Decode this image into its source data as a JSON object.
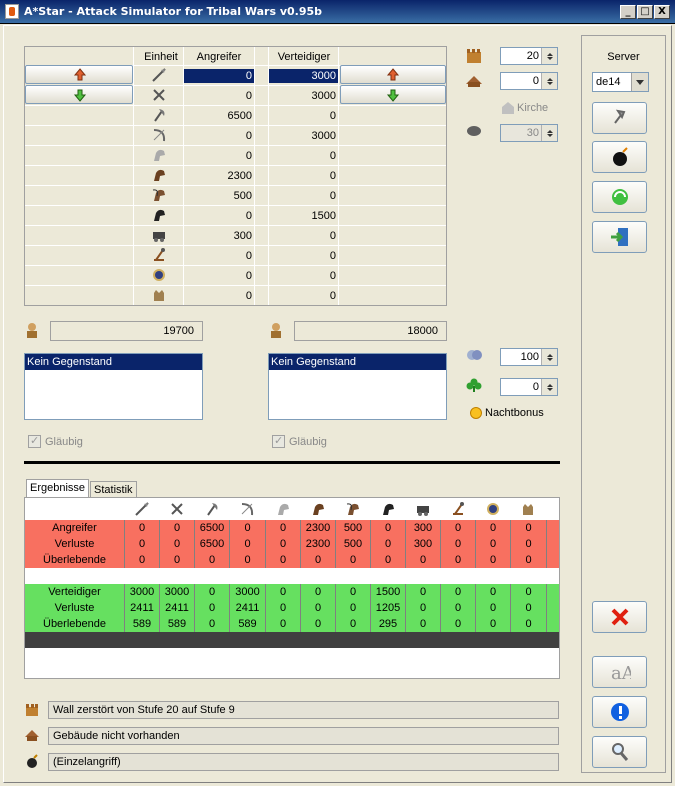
{
  "window": {
    "title": "A*Star - Attack Simulator for Tribal Wars v0.95b",
    "controls": {
      "minimize": "_",
      "maximize": "□",
      "close": "X"
    }
  },
  "units_table": {
    "headers": {
      "unit": "Einheit",
      "attacker": "Angreifer",
      "defender": "Verteidiger"
    },
    "rows": [
      {
        "icon": "spear-icon",
        "attacker": "0",
        "defender": "3000"
      },
      {
        "icon": "sword-icon",
        "attacker": "0",
        "defender": "3000"
      },
      {
        "icon": "axe-icon",
        "attacker": "6500",
        "defender": "0"
      },
      {
        "icon": "archer-icon",
        "attacker": "0",
        "defender": "3000"
      },
      {
        "icon": "scout-icon",
        "attacker": "0",
        "defender": "0"
      },
      {
        "icon": "light-cavalry-icon",
        "attacker": "2300",
        "defender": "0"
      },
      {
        "icon": "mounted-archer-icon",
        "attacker": "500",
        "defender": "0"
      },
      {
        "icon": "heavy-cavalry-icon",
        "attacker": "0",
        "defender": "1500"
      },
      {
        "icon": "ram-icon",
        "attacker": "300",
        "defender": "0"
      },
      {
        "icon": "catapult-icon",
        "attacker": "0",
        "defender": "0"
      },
      {
        "icon": "paladin-icon",
        "attacker": "0",
        "defender": "0"
      },
      {
        "icon": "noble-icon",
        "attacker": "0",
        "defender": "0"
      }
    ]
  },
  "right_controls": {
    "wall_level": "20",
    "building_level": "0",
    "church_label": "Kirche",
    "church_value": "30",
    "morale": "100",
    "luck": "0",
    "night_bonus": "Nachtbonus"
  },
  "attacker_total": "19700",
  "defender_total": "18000",
  "attacker_item": "Kein Gegenstand",
  "defender_item": "Kein Gegenstand",
  "believer_label": "Gläubig",
  "tabs": [
    "Ergebnisse",
    "Statistik"
  ],
  "results": {
    "unit_icons": [
      "spear-icon",
      "sword-icon",
      "axe-icon",
      "archer-icon",
      "scout-icon",
      "light-cavalry-icon",
      "mounted-archer-icon",
      "heavy-cavalry-icon",
      "ram-icon",
      "catapult-icon",
      "paladin-icon",
      "noble-icon"
    ],
    "attacker_rows": [
      {
        "label": "Angreifer",
        "values": [
          "0",
          "0",
          "6500",
          "0",
          "0",
          "2300",
          "500",
          "0",
          "300",
          "0",
          "0",
          "0"
        ]
      },
      {
        "label": "Verluste",
        "values": [
          "0",
          "0",
          "6500",
          "0",
          "0",
          "2300",
          "500",
          "0",
          "300",
          "0",
          "0",
          "0"
        ]
      },
      {
        "label": "Überlebende",
        "values": [
          "0",
          "0",
          "0",
          "0",
          "0",
          "0",
          "0",
          "0",
          "0",
          "0",
          "0",
          "0"
        ]
      }
    ],
    "defender_rows": [
      {
        "label": "Verteidiger",
        "values": [
          "3000",
          "3000",
          "0",
          "3000",
          "0",
          "0",
          "0",
          "1500",
          "0",
          "0",
          "0",
          "0"
        ]
      },
      {
        "label": "Verluste",
        "values": [
          "2411",
          "2411",
          "0",
          "2411",
          "0",
          "0",
          "0",
          "1205",
          "0",
          "0",
          "0",
          "0"
        ]
      },
      {
        "label": "Überlebende",
        "values": [
          "589",
          "589",
          "0",
          "589",
          "0",
          "0",
          "0",
          "295",
          "0",
          "0",
          "0",
          "0"
        ]
      }
    ]
  },
  "status_lines": [
    {
      "icon": "wall-icon",
      "text": "Wall zerstört von Stufe 20 auf Stufe 9"
    },
    {
      "icon": "building-icon",
      "text": "Gebäude nicht vorhanden"
    },
    {
      "icon": "bomb-icon",
      "text": "(Einzelangriff)"
    }
  ],
  "sidebar": {
    "server_label": "Server",
    "server_value": "de14",
    "buttons": [
      "settings-icon",
      "bomb-icon",
      "recycle-icon",
      "exit-icon",
      "close-icon",
      "font-icon",
      "info-icon",
      "search-icon"
    ]
  },
  "colors": {
    "attacker_rows": "#f87060",
    "defender_rows": "#66e060",
    "selection": "#0a246a"
  }
}
